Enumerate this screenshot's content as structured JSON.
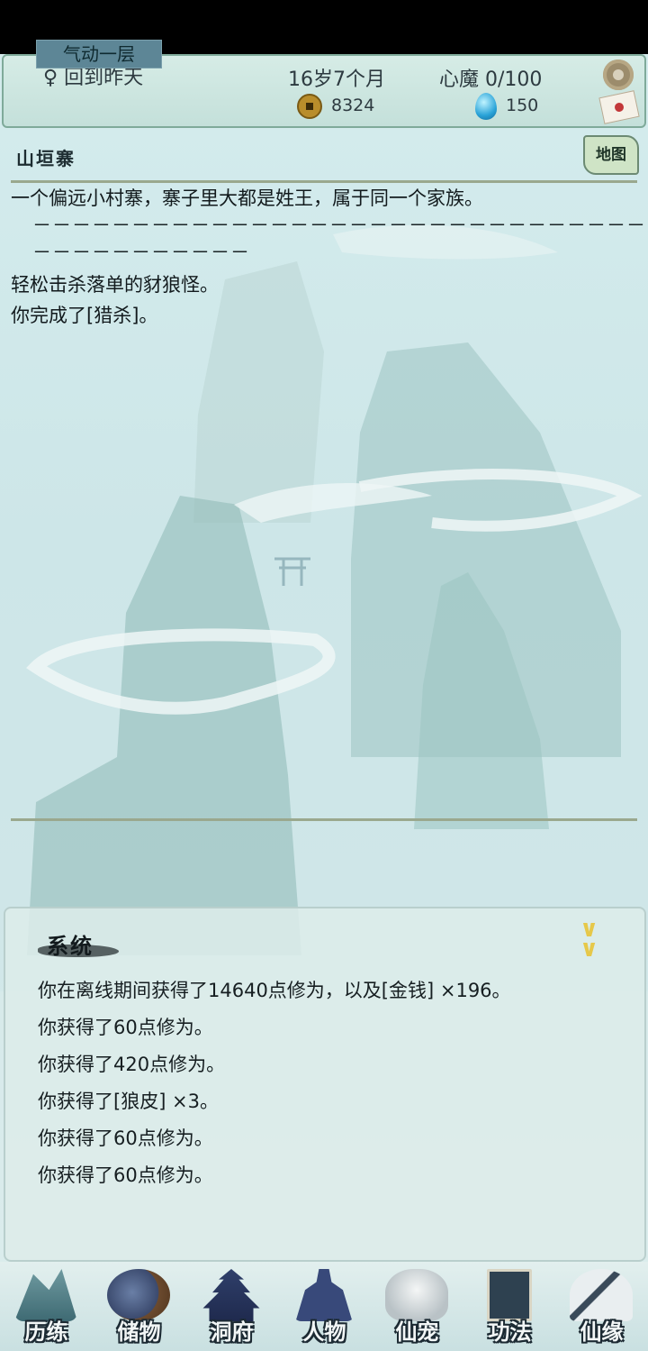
{
  "header": {
    "character_name": "回到昨天",
    "age": "16岁7个月",
    "heart_demon": "心魔  0/100",
    "realm": "气动一层",
    "coins": "8324",
    "spirit_stones": "150"
  },
  "location": {
    "name": "山垣寨",
    "map_button": "地图",
    "description": "一个偏远小村寨，寨子里大都是姓王，属于同一个家族。",
    "separator": "－－－－－－－－－－－－－－－－－－－－－－－－－－－－－－－－－－－－－－－－－－",
    "log": [
      "轻松击杀落单的豺狼怪。",
      "你完成了[猎杀]。"
    ]
  },
  "system_panel": {
    "title": "系统",
    "messages": [
      "你在离线期间获得了14640点修为，以及[金钱] ×196。",
      "你获得了60点修为。",
      "你获得了420点修为。",
      "你获得了[狼皮] ×3。",
      "你获得了60点修为。",
      "你获得了60点修为。"
    ]
  },
  "bottom_nav": [
    {
      "label": "历练",
      "icon": "mountain-icon"
    },
    {
      "label": "储物",
      "icon": "storage-bag-icon"
    },
    {
      "label": "洞府",
      "icon": "palace-icon"
    },
    {
      "label": "人物",
      "icon": "character-icon"
    },
    {
      "label": "仙宠",
      "icon": "spirit-pet-icon"
    },
    {
      "label": "功法",
      "icon": "scripture-book-icon"
    },
    {
      "label": "仙缘",
      "icon": "crane-icon"
    }
  ],
  "colors": {
    "header_bg": "#c8e2dc",
    "realm_bg": "#5d8696",
    "accent_gold": "#e6c84a",
    "text_dark": "#121a1d"
  }
}
